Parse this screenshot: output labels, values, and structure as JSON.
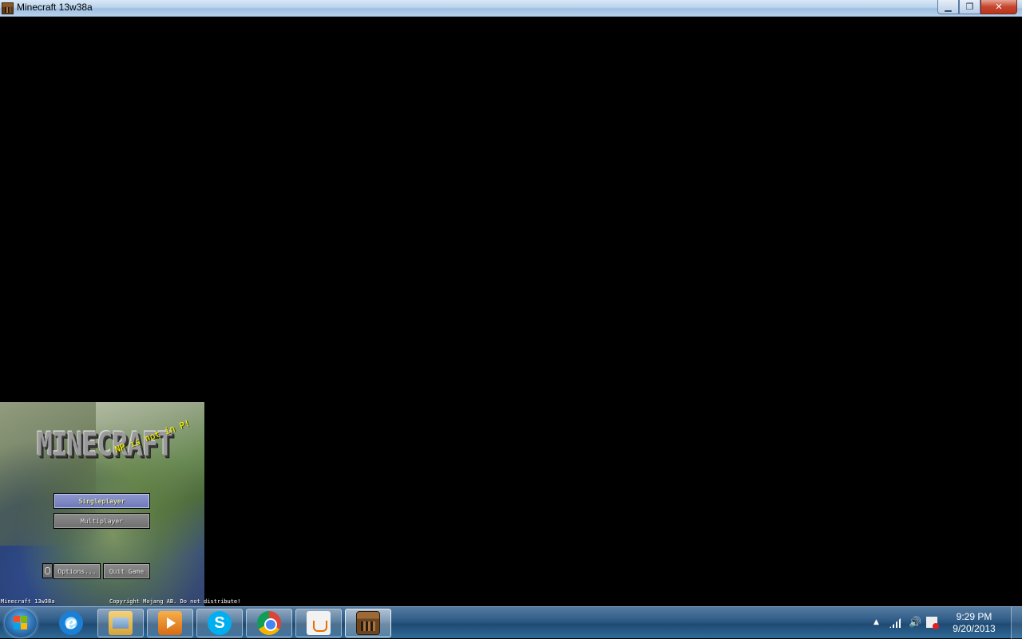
{
  "window": {
    "title": "Minecraft 13w38a",
    "minimize_glyph": "▁",
    "restore_glyph": "❐",
    "close_glyph": "✕"
  },
  "game": {
    "logo_text": "MINECRAFT",
    "splash_text": "NP is not in P!",
    "buttons": {
      "singleplayer": "Singleplayer",
      "multiplayer": "Multiplayer",
      "options": "Options...",
      "quit": "Quit Game"
    },
    "version_text": "Minecraft 13w38a",
    "copyright_text": "Copyright Mojang AB. Do not distribute!"
  },
  "taskbar": {
    "pinned": [
      {
        "name": "internet-explorer",
        "glyph": "e"
      },
      {
        "name": "windows-explorer"
      },
      {
        "name": "media-player"
      },
      {
        "name": "skype",
        "glyph": "S"
      },
      {
        "name": "chrome"
      },
      {
        "name": "java"
      },
      {
        "name": "minecraft"
      }
    ],
    "clock": {
      "time": "9:29 PM",
      "date": "9/20/2013"
    },
    "tray_arrow_glyph": "▲",
    "volume_glyph": "🔊"
  },
  "colors": {
    "background": "#000000",
    "splash": "#ffff00",
    "button_hover": "#7d87c4"
  }
}
